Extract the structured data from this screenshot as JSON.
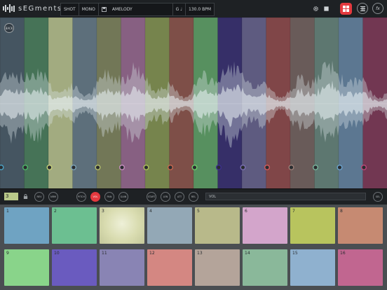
{
  "app": {
    "logo_text": "sEGments"
  },
  "header": {
    "mode": "SHOT",
    "channel": "MONO",
    "file_name": "AMELODY",
    "key": "G ♩",
    "tempo": "130.0 BPM"
  },
  "toolbar": {
    "right_buttons": [
      "grid",
      "fx"
    ]
  },
  "waveform": {
    "back_label": "BACK",
    "segments": [
      {
        "color": "#4d6270"
      },
      {
        "color": "#4f8a63"
      },
      {
        "color": "#c9d49a"
      },
      {
        "color": "#6e8493"
      },
      {
        "color": "#8a8f63"
      },
      {
        "color": "#a5709c"
      },
      {
        "color": "#8fa055"
      },
      {
        "color": "#9a5a4f"
      },
      {
        "color": "#66b06e"
      },
      {
        "color": "#3a2f7a"
      },
      {
        "color": "#6f6a99"
      },
      {
        "color": "#9c4d4f"
      },
      {
        "color": "#7d6a66"
      },
      {
        "color": "#6e8f84"
      },
      {
        "color": "#6c8fb0"
      },
      {
        "color": "#8a3a5c"
      }
    ],
    "marker_colors": [
      "#4ba3c7",
      "#4fb86a",
      "#c6d07a",
      "#7da3b8",
      "#b6c06d",
      "#c88fc0",
      "#b0c259",
      "#c9684f",
      "#6fcf6c",
      "#3c2f8f",
      "#7b6fb3",
      "#d45a5c",
      "#9a7f77",
      "#7ab59c",
      "#6aa3cf",
      "#c0467a"
    ]
  },
  "controls": {
    "pad_number": "3",
    "buttons_a": [
      "REV",
      "NRM",
      "SOFT"
    ],
    "buttons_b": [
      {
        "label": "PITCH",
        "active": false
      },
      {
        "label": "VOL",
        "active": true
      },
      {
        "label": "PAN",
        "active": false
      },
      {
        "label": "GAIN",
        "active": false
      }
    ],
    "buttons_c": [
      "START",
      "LEN",
      "ATT",
      "REL"
    ],
    "param_field": "VOL",
    "end_button": "SEL"
  },
  "pads": [
    {
      "label": "1",
      "color": "#6fa3c2"
    },
    {
      "label": "2",
      "color": "#6cbf91"
    },
    {
      "label": "3",
      "color": "#e6e8c6"
    },
    {
      "label": "4",
      "color": "#93a8b6"
    },
    {
      "label": "5",
      "color": "#b8b98a"
    },
    {
      "label": "6",
      "color": "#d3a5cb"
    },
    {
      "label": "7",
      "color": "#b8c45e"
    },
    {
      "label": "8",
      "color": "#c68a72"
    },
    {
      "label": "9",
      "color": "#89d48a"
    },
    {
      "label": "10",
      "color": "#6a5bbf"
    },
    {
      "label": "11",
      "color": "#8984b4"
    },
    {
      "label": "12",
      "color": "#d48782"
    },
    {
      "label": "13",
      "color": "#b4a49a"
    },
    {
      "label": "14",
      "color": "#8ab89a"
    },
    {
      "label": "15",
      "color": "#8fb1cf"
    },
    {
      "label": "16",
      "color": "#c16690"
    }
  ]
}
